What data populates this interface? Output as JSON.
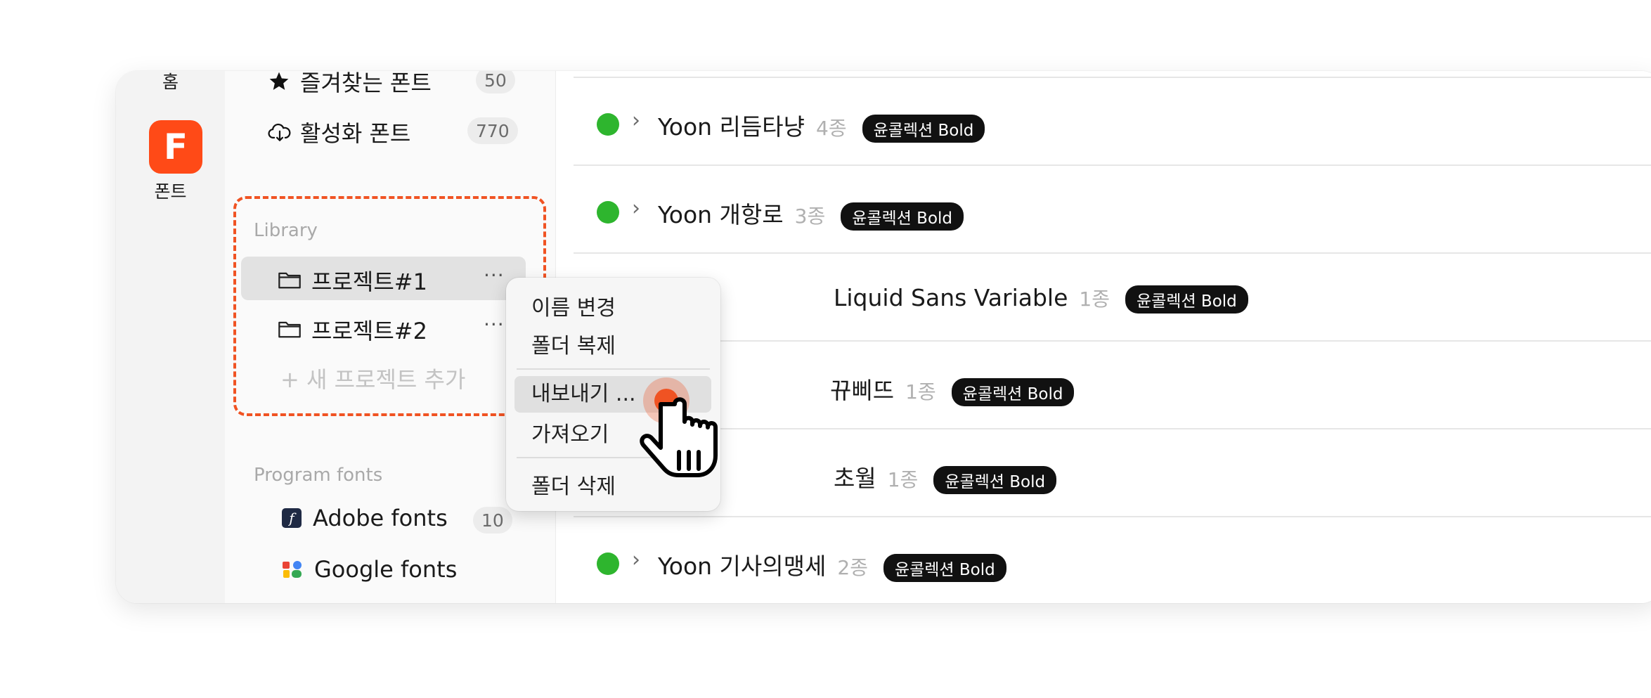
{
  "rail": {
    "home_label": "홈",
    "app_letter": "F",
    "app_label": "폰트",
    "accent": "#ff4a17"
  },
  "sidebar": {
    "favorites": {
      "label": "즐겨찾는 폰트",
      "count": "50"
    },
    "activated": {
      "label": "활성화 폰트",
      "count": "770"
    },
    "library_title": "Library",
    "projects": [
      {
        "label": "프로젝트#1",
        "more": "···"
      },
      {
        "label": "프로젝트#2",
        "more": "···"
      }
    ],
    "add_project": "+ 새 프로젝트 추가",
    "program_fonts_title": "Program fonts",
    "adobe": {
      "label": "Adobe fonts",
      "count": "10"
    },
    "google": {
      "label": "Google fonts"
    }
  },
  "context_menu": {
    "rename": "이름 변경",
    "duplicate": "폴더 복제",
    "export": "내보내기 ...",
    "import": "가져오기",
    "delete": "폴더 삭제"
  },
  "font_list": [
    {
      "name": "Yoon 리듬타냥",
      "count": "4종",
      "tag": "윤콜렉션 Bold"
    },
    {
      "name": "Yoon 개항로",
      "count": "3종",
      "tag": "윤콜렉션 Bold"
    },
    {
      "name": "Liquid Sans Variable",
      "count": "1종",
      "tag": "윤콜렉션 Bold"
    },
    {
      "name": "뀨삐뜨",
      "count": "1종",
      "tag": "윤콜렉션 Bold"
    },
    {
      "name": "초월",
      "count": "1종",
      "tag": "윤콜렉션 Bold"
    },
    {
      "name": "Yoon 기사의맹세",
      "count": "2종",
      "tag": "윤콜렉션 Bold"
    }
  ],
  "colors": {
    "dashed_highlight": "#f05323",
    "status_green": "#2eb52e",
    "tag_bg": "#111111",
    "click_marker": "#f05323"
  }
}
